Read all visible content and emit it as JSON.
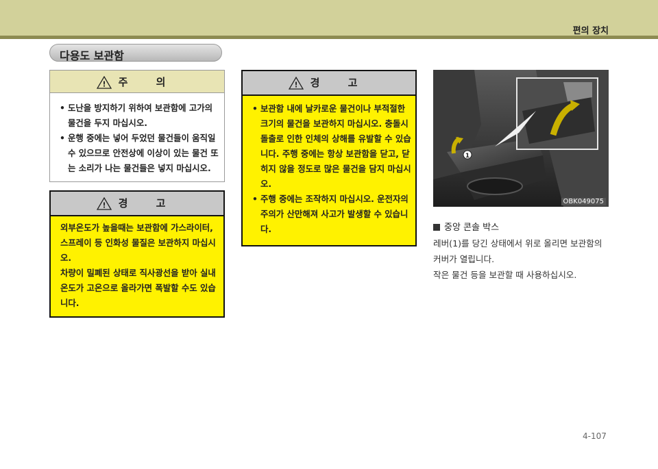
{
  "header": {
    "section": "편의 장치"
  },
  "page_title": "다용도 보관함",
  "caution": {
    "heading": "주 의",
    "items": [
      "도난을 방지하기 위하여 보관함에 고가의 물건을 두지 마십시오.",
      "운행 중에는 넣어 두었던 물건들이 움직일 수 있으므로 안전상에 이상이 있는 물건 또는 소리가 나는 물건들은 넣지 마십시오."
    ]
  },
  "warning_left": {
    "heading": "경 고",
    "lines": [
      "외부온도가 높을때는 보관함에 가스라이터, 스프레이 등 인화성 물질은 보관하지 마십시오.",
      "차량이 밀폐된 상태로 직사광선을 받아 실내 온도가 고온으로 올라가면 폭발할 수도 있습니다."
    ]
  },
  "warning_middle": {
    "heading": "경 고",
    "items": [
      "보관함 내에 날카로운 물건이나 부적절한 크기의 물건을 보관하지 마십시오. 충돌시 돌출로 인한 인체의 상해를 유발할 수 있습니다. 주행 중에는 항상 보관함을 닫고, 닫히지 않을 정도로 많은 물건을 담지 마십시오.",
      "주행 중에는 조작하지 마십시오. 운전자의 주의가 산만해져 사고가 발생할 수 있습니다."
    ]
  },
  "figure": {
    "code": "OBK049075",
    "callout": "1"
  },
  "console_box": {
    "title": "중앙 콘솔 박스",
    "text_lines": [
      "레버(1)를 당긴 상태에서 위로 올리면 보관함의",
      "커버가 열립니다.",
      "작은 물건 등을 보관할 때 사용하십시오."
    ]
  },
  "page_number": "4-107",
  "colors": {
    "banner": "#d2d19a",
    "warning_fill": "#fff200",
    "caution_head": "#e8e4b4"
  }
}
